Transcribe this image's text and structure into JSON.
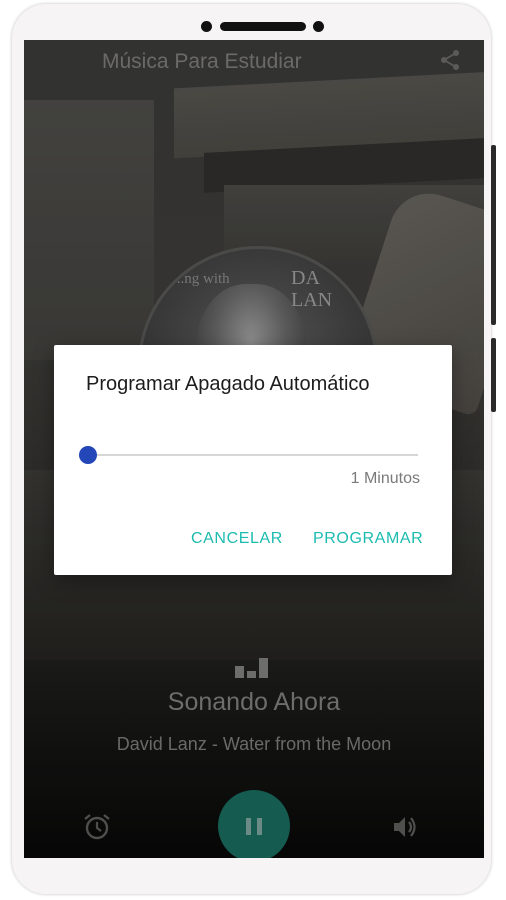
{
  "app": {
    "title": "Música Para Estudiar"
  },
  "album_art": {
    "line1": "...ng with",
    "line2": "DA",
    "line3": "LAN"
  },
  "dialog": {
    "title": "Programar Apagado Automático",
    "slider_value_fraction": 0,
    "minutes_label": "1 Minutos",
    "cancel_label": "CANCELAR",
    "program_label": "PROGRAMAR"
  },
  "player": {
    "status": "Sonando Ahora",
    "track": "David Lanz - Water from the Moon",
    "state": "playing"
  },
  "colors": {
    "accent": "#1bbcb0",
    "slider_thumb": "#2346b8",
    "play_button": "#155b4f"
  },
  "icons": [
    "share-icon",
    "equalizer-icon",
    "alarm-icon",
    "pause-icon",
    "volume-icon"
  ]
}
